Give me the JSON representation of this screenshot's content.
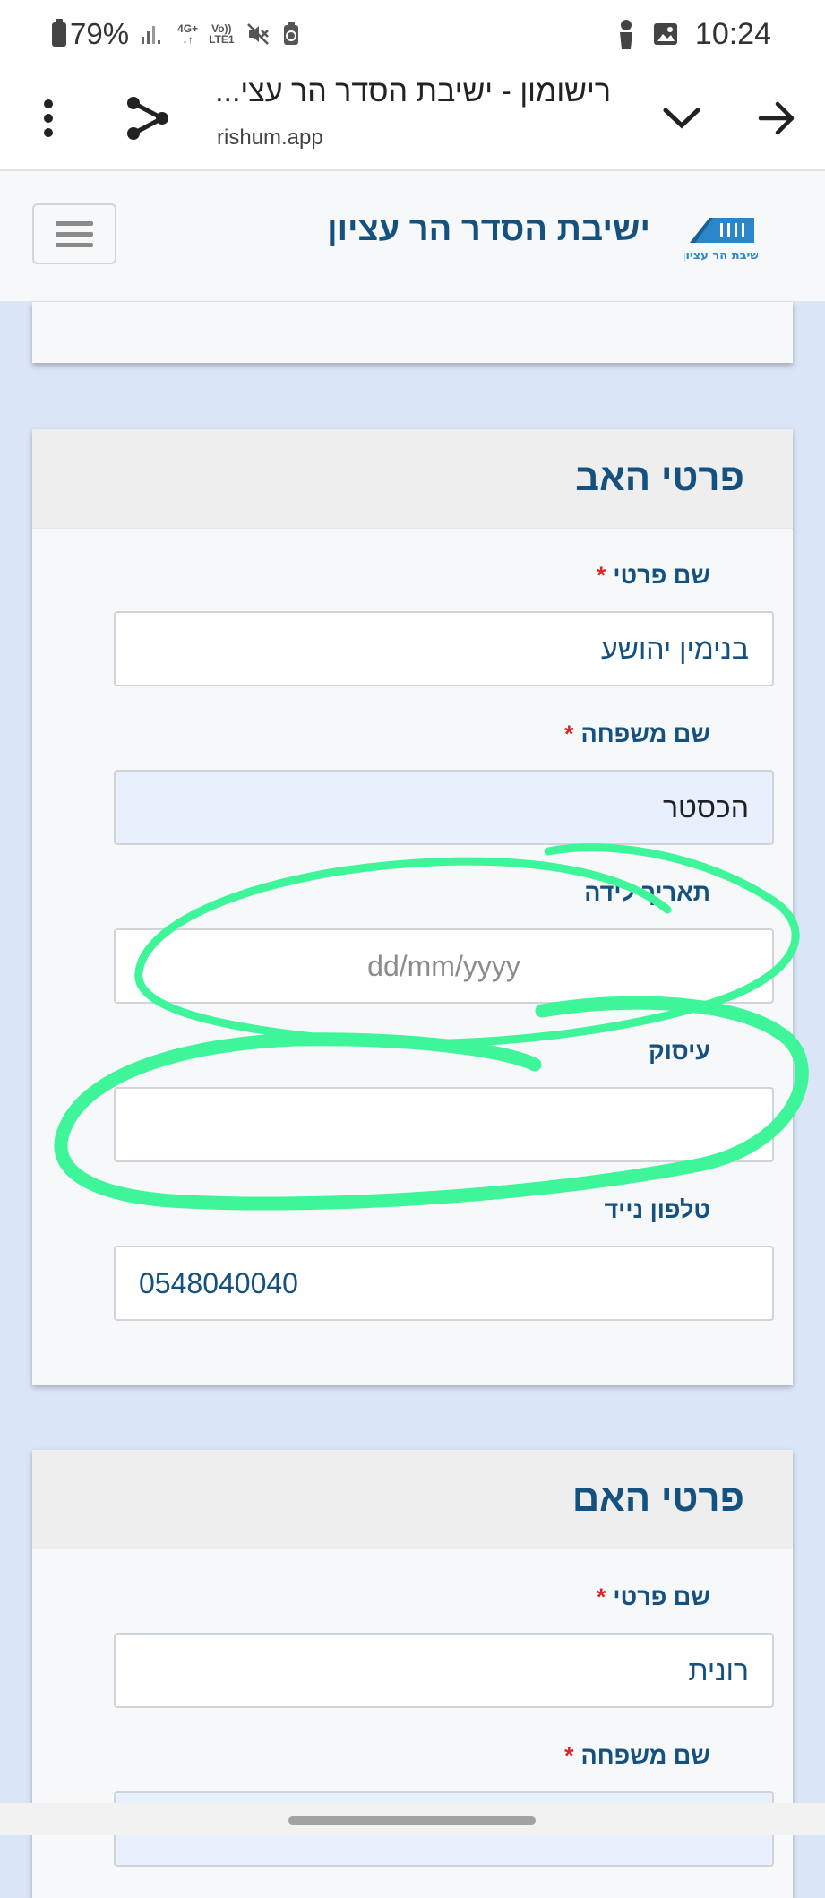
{
  "status_bar": {
    "battery": "79%",
    "network_top": "4G+",
    "network_bottom": "LTE1",
    "volte_top": "Vo))",
    "volte_bottom": "LTE1",
    "time": "10:24"
  },
  "browser": {
    "tab_title": "רישומון - ישיבת הסדר הר עצי...",
    "url": "rishum.app"
  },
  "site": {
    "title": "ישיבת הסדר הר עציון",
    "logo_text": "ישיבת הר עציון",
    "logo_color": "#2a86c8"
  },
  "father": {
    "heading": "פרטי האב",
    "first_name_label": "שם פרטי",
    "first_name_value": "בנימין יהושע",
    "last_name_label": "שם משפחה",
    "last_name_value": "הכסטר",
    "birth_date_label": "תאריך לידה",
    "birth_date_placeholder": "dd/mm/yyyy",
    "occupation_label": "עיסוק",
    "occupation_value": "",
    "mobile_label": "טלפון נייד",
    "mobile_value": "0548040040"
  },
  "mother": {
    "heading": "פרטי האם",
    "first_name_label": "שם פרטי",
    "first_name_value": "רונית",
    "last_name_label": "שם משפחה"
  },
  "required_marker": "*",
  "colors": {
    "brand_blue": "#15517f",
    "required_red": "#d9262b",
    "annotation_green": "#3ff59a",
    "page_background": "#dbe5f8"
  }
}
